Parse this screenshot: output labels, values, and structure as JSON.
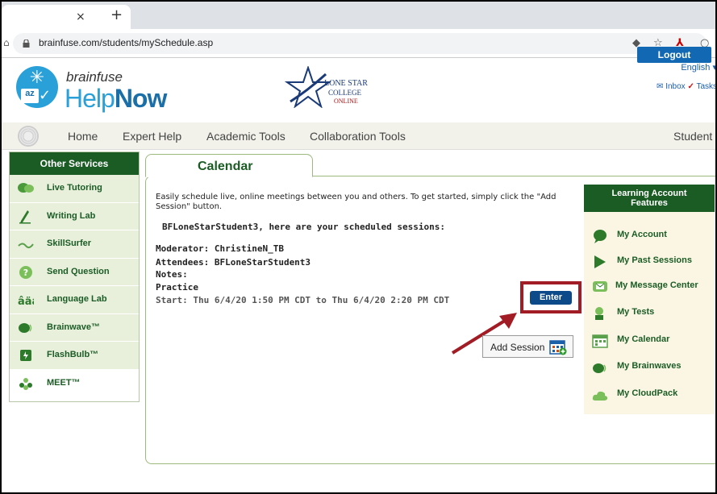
{
  "browser": {
    "tab_close": "×",
    "tab_new": "+",
    "url": "brainfuse.com/students/mySchedule.asp"
  },
  "header": {
    "brand_small": "brainfuse",
    "brand_help": "Help",
    "brand_now": "Now",
    "partner_line1": "LONE STAR",
    "partner_line2": "COLLEGE",
    "partner_line3": "ONLINE",
    "language": "English ▾",
    "inbox": "Inbox",
    "tasks": "Tasks",
    "logout": "Logout"
  },
  "nav": {
    "items": [
      "Home",
      "Expert Help",
      "Academic Tools",
      "Collaboration Tools"
    ],
    "user": "Student ▾"
  },
  "sidebar": {
    "title": "Other Services",
    "items": [
      {
        "label": "Live Tutoring",
        "icon": "tutoring-icon"
      },
      {
        "label": "Writing Lab",
        "icon": "writing-icon"
      },
      {
        "label": "SkillSurfer",
        "icon": "skillsurfer-icon"
      },
      {
        "label": "Send Question",
        "icon": "question-icon"
      },
      {
        "label": "Language Lab",
        "icon": "language-icon"
      },
      {
        "label": "Brainwave™",
        "icon": "brainwave-icon"
      },
      {
        "label": "FlashBulb™",
        "icon": "flashbulb-icon"
      },
      {
        "label": "MEET™",
        "icon": "meet-icon"
      }
    ]
  },
  "main": {
    "tab": "Calendar",
    "intro": "Easily schedule live, online meetings between you and others. To get started, simply click the \"Add Session\" button.",
    "greeting": "BFLoneStarStudent3, here are your scheduled sessions:",
    "moderator": "Moderator: ChristineN_TB",
    "attendees": "Attendees: BFLoneStarStudent3",
    "notes": "Notes:",
    "practice": "Practice",
    "start": "Start: Thu 6/4/20 1:50 PM CDT to Thu 6/4/20 2:20 PM CDT",
    "enter": "Enter",
    "add_session": "Add Session"
  },
  "right_panel": {
    "title_line1": "Learning Account",
    "title_line2": "Features",
    "items": [
      "My Account",
      "My Past Sessions",
      "My Message Center",
      "My Tests",
      "My Calendar",
      "My Brainwaves",
      "My CloudPack"
    ]
  },
  "colors": {
    "dark_green": "#1b5c25",
    "light_green": "#e8f0dc",
    "blue": "#1268b3",
    "highlight": "#a21c26"
  }
}
